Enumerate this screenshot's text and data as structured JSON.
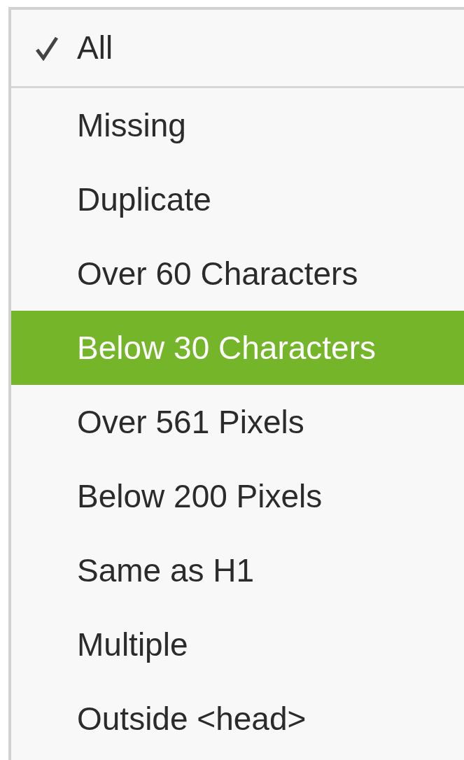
{
  "menu": {
    "header": {
      "label": "All",
      "checked": true
    },
    "items": [
      {
        "label": "Missing",
        "selected": false
      },
      {
        "label": "Duplicate",
        "selected": false
      },
      {
        "label": "Over 60 Characters",
        "selected": false
      },
      {
        "label": "Below 30 Characters",
        "selected": true
      },
      {
        "label": "Over 561 Pixels",
        "selected": false
      },
      {
        "label": "Below 200 Pixels",
        "selected": false
      },
      {
        "label": "Same as H1",
        "selected": false
      },
      {
        "label": "Multiple",
        "selected": false
      },
      {
        "label": "Outside <head>",
        "selected": false
      }
    ]
  }
}
